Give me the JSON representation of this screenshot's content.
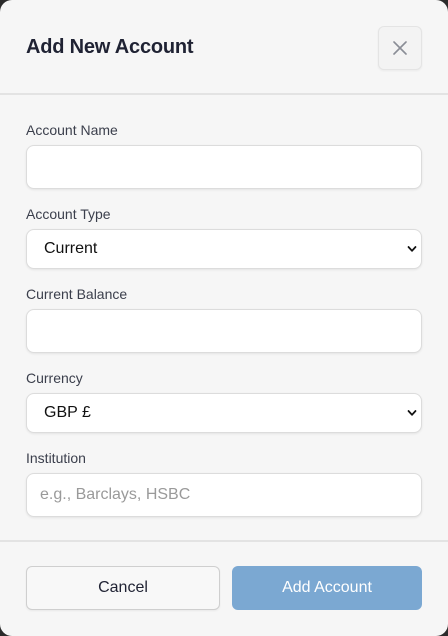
{
  "modal": {
    "title": "Add New Account",
    "close_icon": "close-icon"
  },
  "form": {
    "account_name": {
      "label": "Account Name",
      "value": "",
      "placeholder": ""
    },
    "account_type": {
      "label": "Account Type",
      "selected": "Current"
    },
    "current_balance": {
      "label": "Current Balance",
      "value": "",
      "placeholder": ""
    },
    "currency": {
      "label": "Currency",
      "selected": "GBP £"
    },
    "institution": {
      "label": "Institution",
      "value": "",
      "placeholder": "e.g., Barclays, HSBC"
    }
  },
  "footer": {
    "cancel_label": "Cancel",
    "submit_label": "Add Account"
  },
  "colors": {
    "primary_button": "#7ba8d2",
    "background": "#f6f6f6"
  }
}
